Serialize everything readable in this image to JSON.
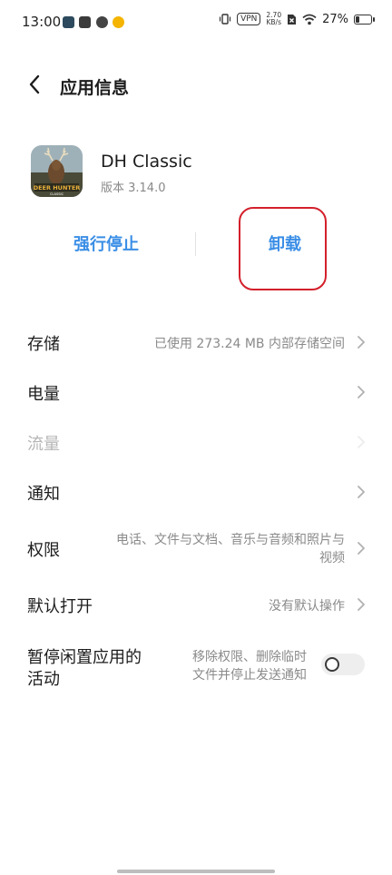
{
  "status_bar": {
    "time": "13:00",
    "vpn": "VPN",
    "speed_value": "2.70",
    "speed_unit": "KB/s",
    "battery_percent": "27%",
    "battery_level": 0.27
  },
  "header": {
    "title": "应用信息"
  },
  "app": {
    "name": "DH Classic",
    "version": "版本 3.14.0",
    "icon_text_line1": "DEER HUNTER",
    "icon_text_line2": "CLASSIC"
  },
  "actions": {
    "force_stop": "强行停止",
    "uninstall": "卸载"
  },
  "rows": {
    "storage": {
      "label": "存储",
      "value": "已使用 273.24 MB 内部存储空间"
    },
    "battery": {
      "label": "电量",
      "value": ""
    },
    "data": {
      "label": "流量",
      "value": ""
    },
    "notifications": {
      "label": "通知",
      "value": ""
    },
    "permissions": {
      "label": "权限",
      "value_line1": "电话、文件与文档、音乐与音频和照片与",
      "value_line2": "视频"
    },
    "default_open": {
      "label": "默认打开",
      "value": "没有默认操作"
    },
    "pause_app": {
      "label_line1": "暂停闲置应用的",
      "label_line2": "活动",
      "desc_line1": "移除权限、删除临时",
      "desc_line2": "文件并停止发送通知",
      "toggle_on": false
    }
  },
  "colors": {
    "accent": "#3a8ee6",
    "highlight": "#d3202b",
    "secondary_text": "#8a8a8a"
  }
}
